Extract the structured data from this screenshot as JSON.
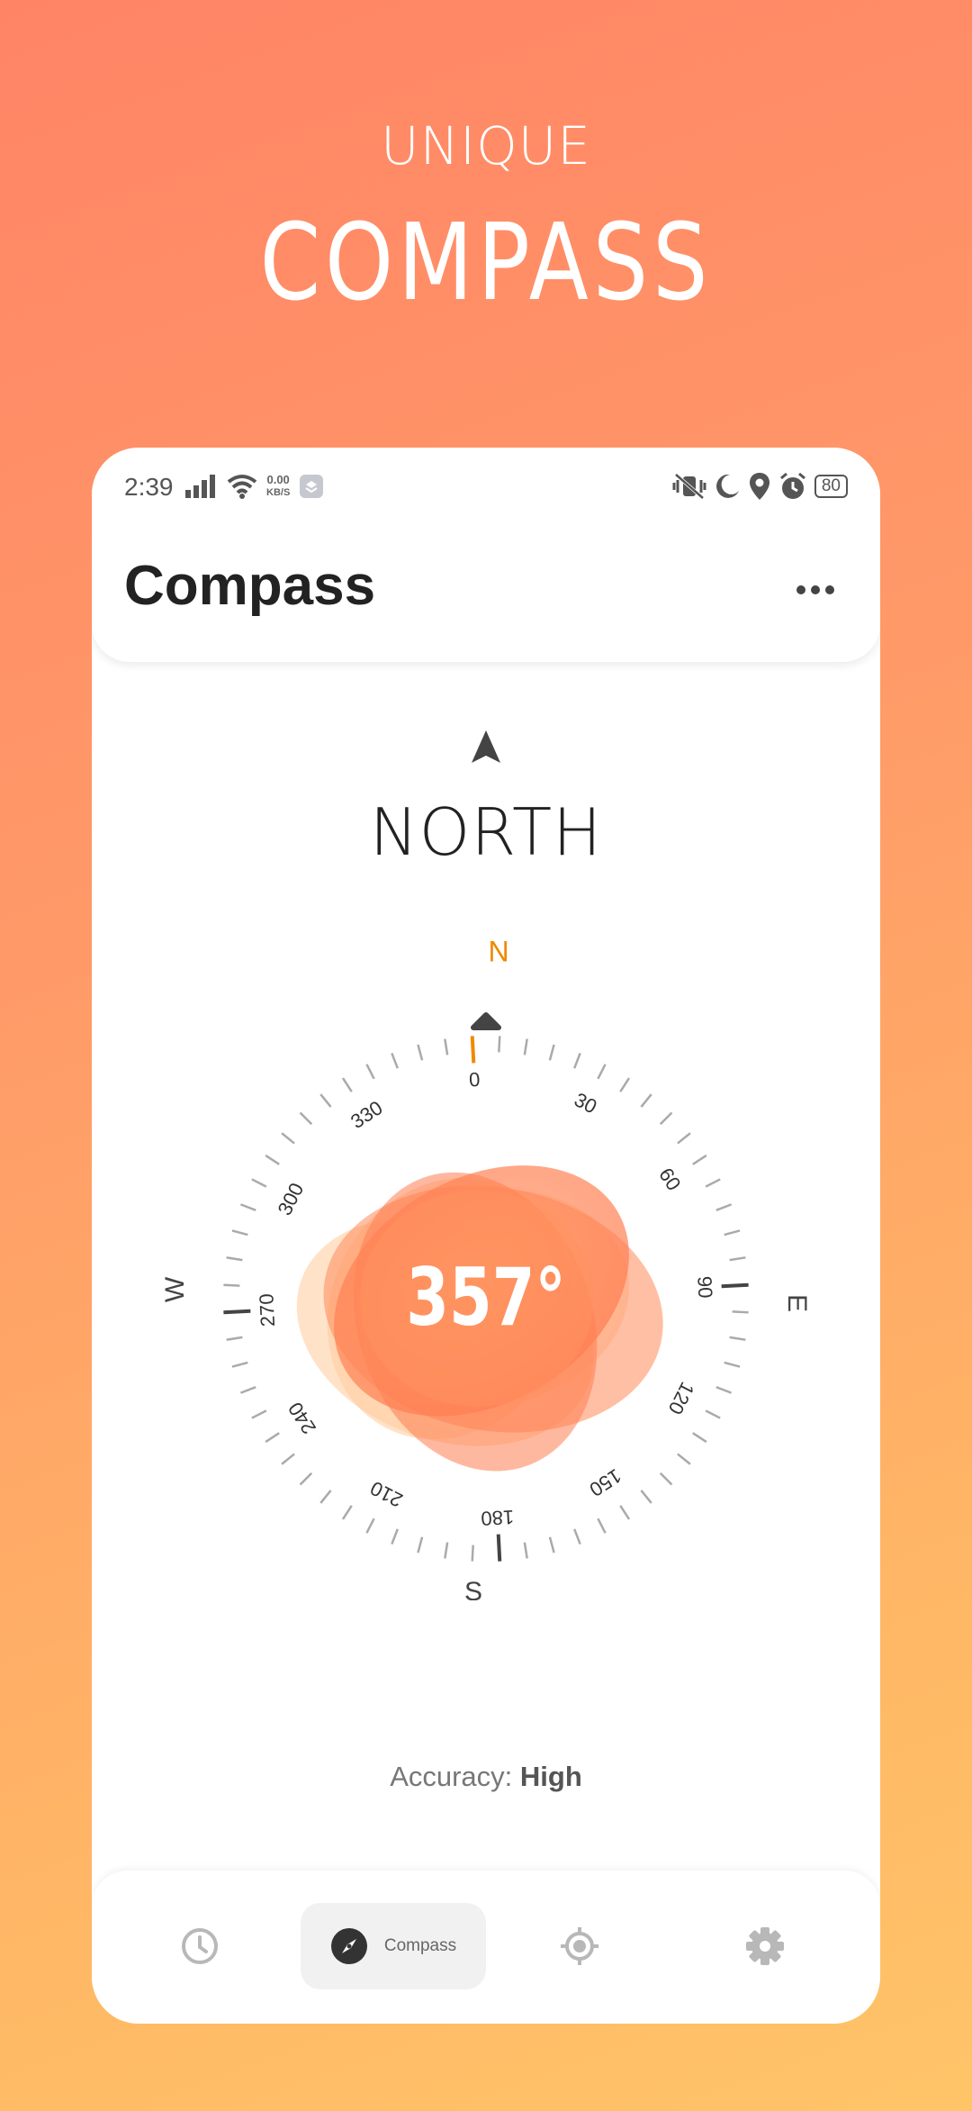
{
  "promo": {
    "subtitle": "UNIQUE",
    "title": "COMPASS"
  },
  "status_bar": {
    "time": "2:39",
    "speed_value": "0.00",
    "speed_unit": "KB/S",
    "battery": "80"
  },
  "app": {
    "title": "Compass"
  },
  "compass": {
    "direction": "NORTH",
    "heading": "357°",
    "cardinals": {
      "n": "N",
      "e": "E",
      "s": "S",
      "w": "W"
    },
    "degree_labels": [
      "0",
      "30",
      "60",
      "90",
      "120",
      "150",
      "180",
      "210",
      "240",
      "270",
      "300",
      "330"
    ],
    "accent_color": "#ef8a00"
  },
  "accuracy": {
    "label": "Accuracy:",
    "value": "High"
  },
  "bottom_nav": {
    "compass_label": "Compass"
  }
}
